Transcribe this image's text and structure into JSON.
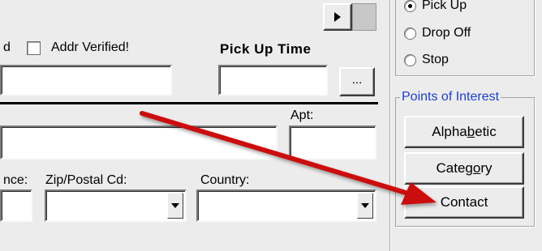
{
  "form": {
    "addr_verified_prefix": "d",
    "addr_verified_label": "Addr Verified!",
    "pickup_time_label": "Pick Up Time",
    "ellipsis_label": "...",
    "apt_label": "Apt:",
    "province_partial_label": "nce:",
    "zip_label": "Zip/Postal Cd:",
    "country_label": "Country:"
  },
  "stop_type": {
    "options": [
      {
        "label": "Pick Up",
        "selected": true
      },
      {
        "label": "Drop Off",
        "selected": false
      },
      {
        "label": "Stop",
        "selected": false
      }
    ]
  },
  "points_of_interest": {
    "title": "Points of Interest",
    "buttons": [
      "Alphabetic",
      "Category",
      "Contact"
    ]
  },
  "annotation": {
    "arrow_color": "#cc1111",
    "arrow_target": "contact-button"
  },
  "colors": {
    "background": "#ececec",
    "group_title": "#1a3fd0"
  }
}
